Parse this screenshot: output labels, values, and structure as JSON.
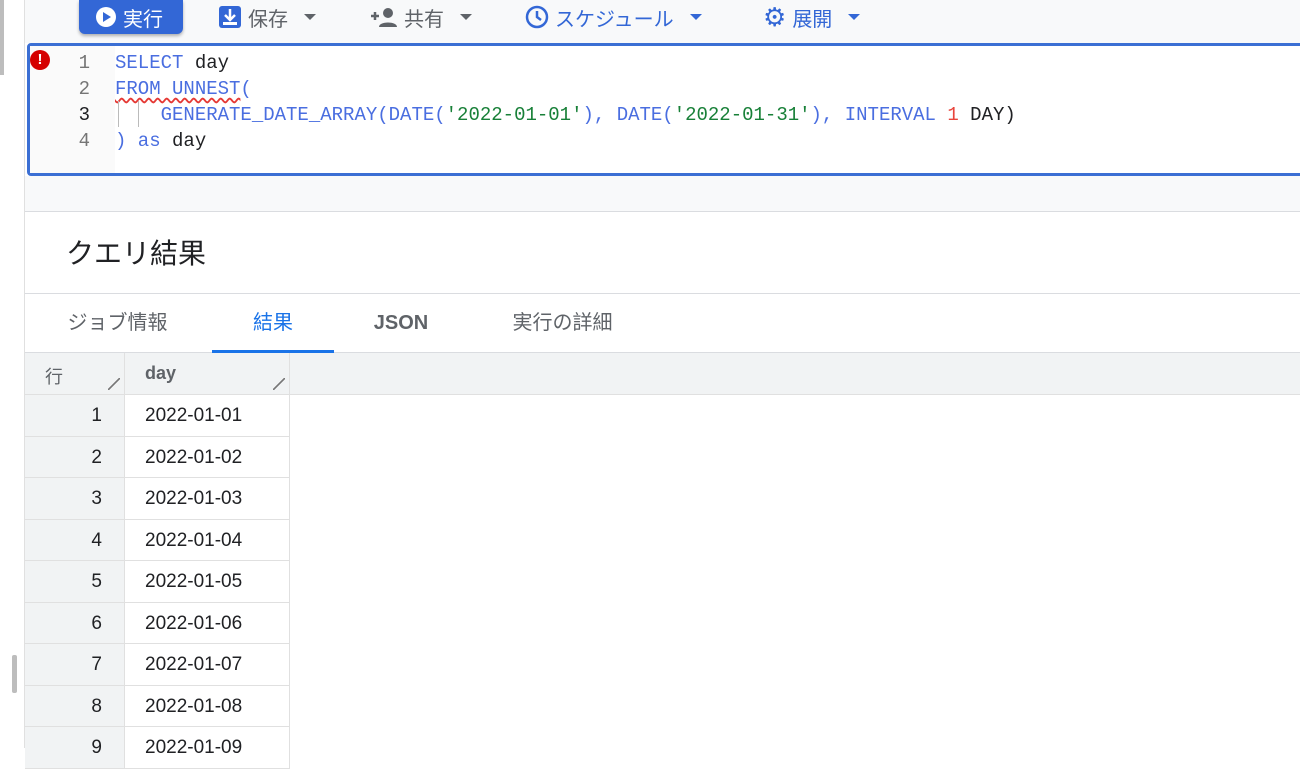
{
  "toolbar": {
    "run": "実行",
    "save": "保存",
    "share": "共有",
    "schedule": "スケジュール",
    "deploy": "展開"
  },
  "editor": {
    "lines": [
      {
        "n": "1",
        "parts": [
          [
            "kw",
            "SELECT"
          ],
          [
            "tx",
            " day"
          ]
        ]
      },
      {
        "n": "2",
        "parts": [
          [
            "kw squig",
            "FROM UNNEST"
          ],
          [
            "kw",
            "("
          ]
        ]
      },
      {
        "n": "3",
        "parts": [
          [
            "tx",
            "    "
          ],
          [
            "kw",
            "GENERATE_DATE_ARRAY(DATE("
          ],
          [
            "str",
            "'2022-01-01'"
          ],
          [
            "kw",
            "), DATE("
          ],
          [
            "str",
            "'2022-01-31'"
          ],
          [
            "kw",
            "), INTERVAL "
          ],
          [
            "num",
            "1"
          ],
          [
            "tx",
            " DAY)"
          ]
        ]
      },
      {
        "n": "4",
        "parts": [
          [
            "kw",
            ") as"
          ],
          [
            "tx",
            " day"
          ]
        ]
      }
    ],
    "error_marker": "!"
  },
  "results": {
    "title": "クエリ結果",
    "tabs": [
      "ジョブ情報",
      "結果",
      "JSON",
      "実行の詳細"
    ],
    "active_tab": 1,
    "columns": [
      "行",
      "day"
    ],
    "rows": [
      [
        "1",
        "2022-01-01"
      ],
      [
        "2",
        "2022-01-02"
      ],
      [
        "3",
        "2022-01-03"
      ],
      [
        "4",
        "2022-01-04"
      ],
      [
        "5",
        "2022-01-05"
      ],
      [
        "6",
        "2022-01-06"
      ],
      [
        "7",
        "2022-01-07"
      ],
      [
        "8",
        "2022-01-08"
      ],
      [
        "9",
        "2022-01-09"
      ]
    ]
  }
}
